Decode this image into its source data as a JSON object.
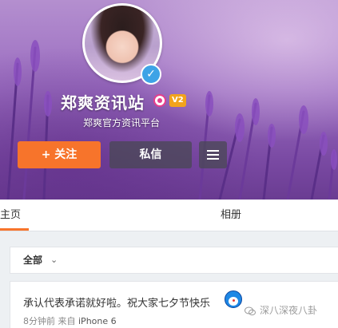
{
  "profile": {
    "nickname": "郑爽资讯站",
    "level_badge": "V2",
    "subtitle": "郑爽官方资讯平台",
    "verified_mark": "✓"
  },
  "actions": {
    "follow_label": "+ 关注",
    "message_label": "私信"
  },
  "tabs": [
    {
      "label": "主页"
    },
    {
      "label": "相册"
    }
  ],
  "filter": {
    "label": "全部",
    "chevron": "⌄"
  },
  "post": {
    "text": "承认代表承诺就好啦。祝大家七夕节快乐",
    "time": "8分钟前",
    "source_prefix": "来自",
    "device": "iPhone 6"
  },
  "watermark": {
    "text": "深八深夜八卦"
  },
  "colors": {
    "accent": "#f7742b",
    "verified": "#3ea3e6",
    "banner": "#9a6cc0"
  },
  "icons": [
    "verified-icon",
    "member-icon",
    "level-icon",
    "menu-icon",
    "chevron-down-icon",
    "emoji-icon",
    "wechat-icon"
  ]
}
